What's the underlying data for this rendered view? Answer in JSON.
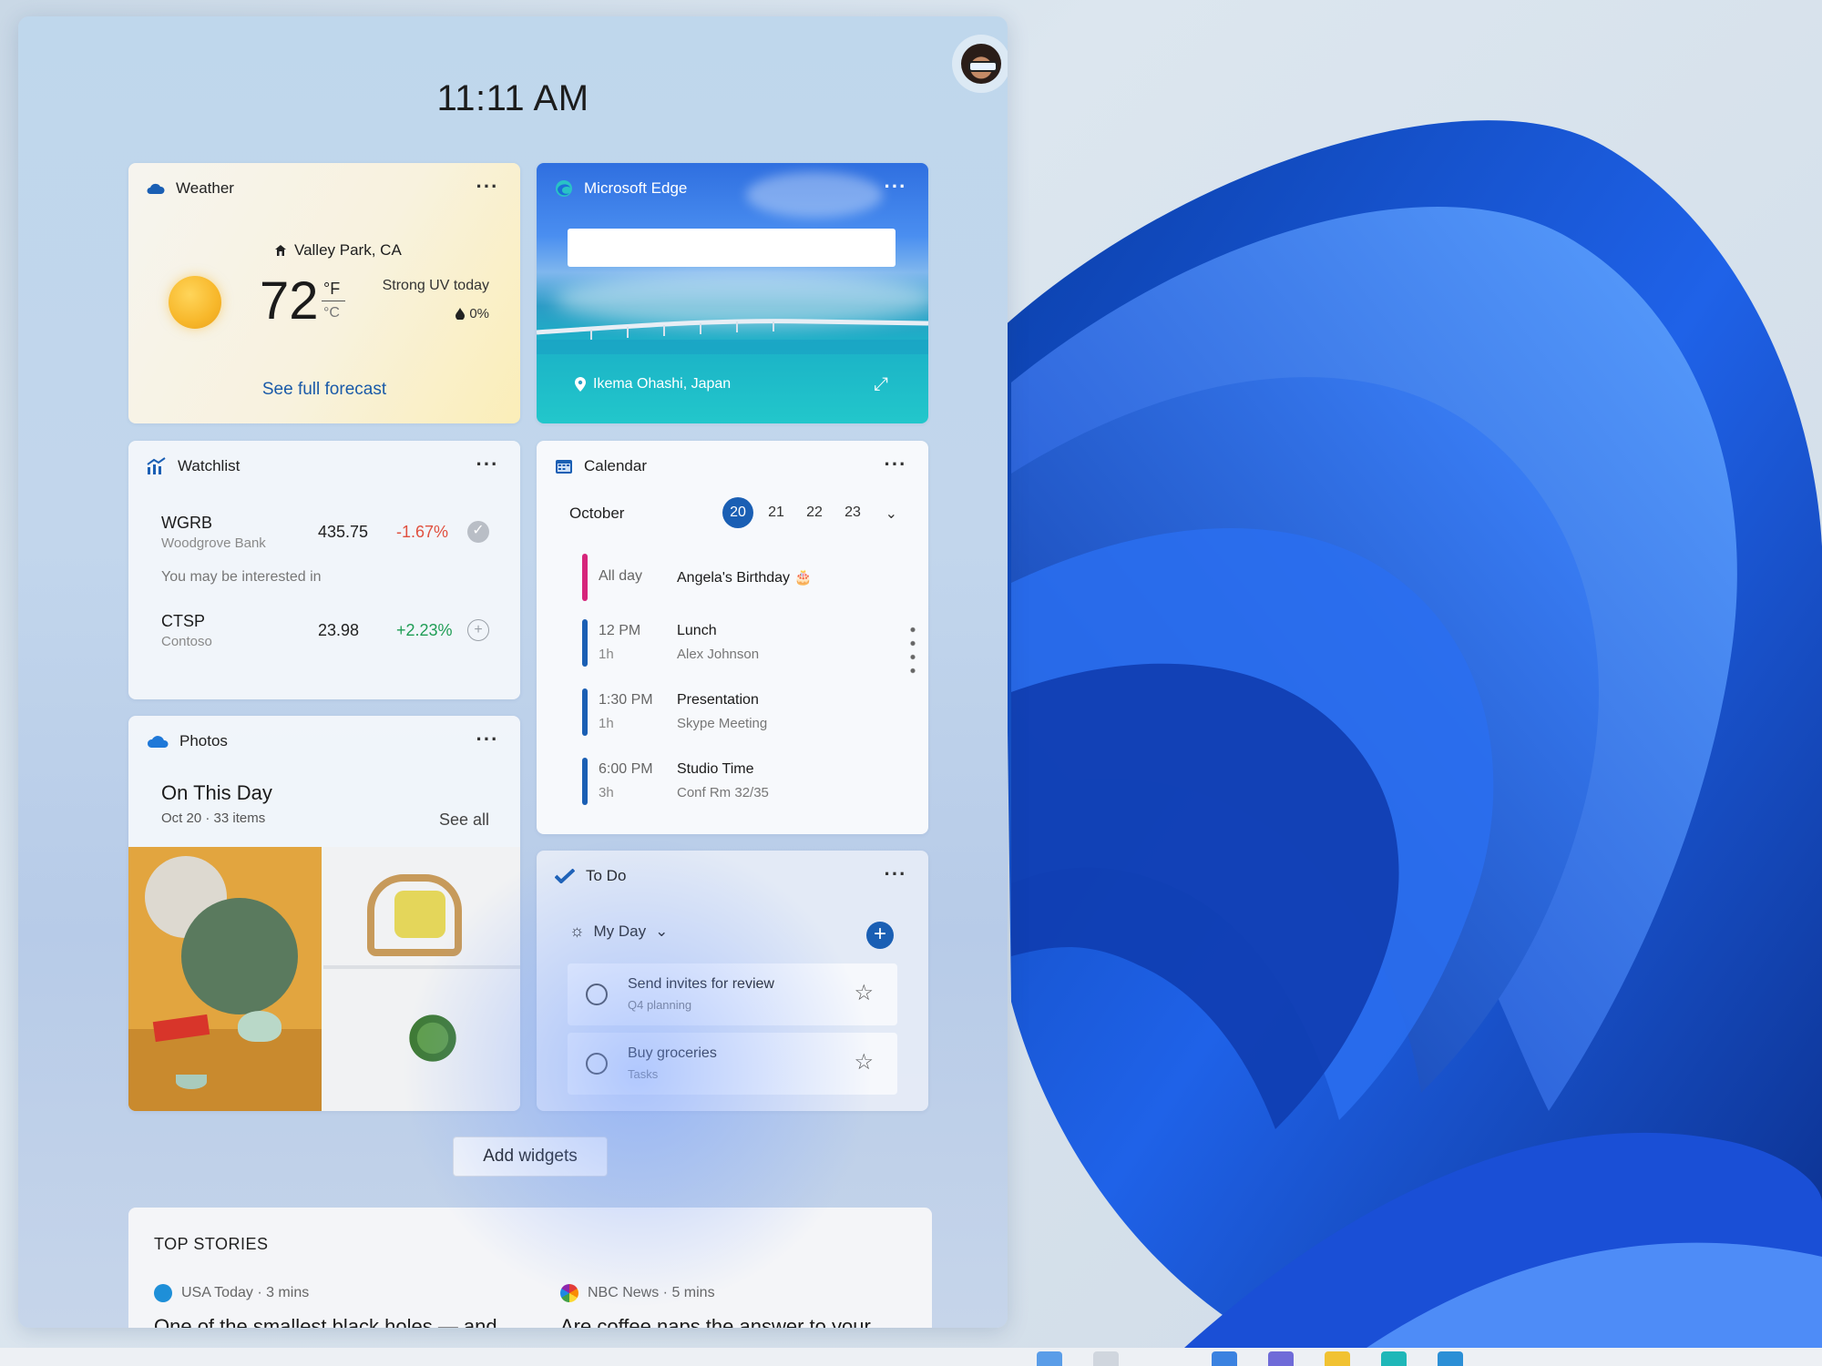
{
  "clock": {
    "time": "11:11 AM"
  },
  "weather": {
    "title": "Weather",
    "location": "Valley Park, CA",
    "temp": "72",
    "unit_f": "°F",
    "unit_c": "°C",
    "uv": "Strong UV today",
    "precip": "0%",
    "forecast_link": "See full forecast"
  },
  "edge": {
    "title": "Microsoft Edge",
    "search_placeholder": "",
    "location": "Ikema Ohashi, Japan"
  },
  "watchlist": {
    "title": "Watchlist",
    "stocks": [
      {
        "symbol": "WGRB",
        "name": "Woodgrove Bank",
        "price": "435.75",
        "change": "-1.67%"
      },
      {
        "symbol": "CTSP",
        "name": "Contoso",
        "price": "23.98",
        "change": "+2.23%"
      }
    ],
    "note": "You may be interested in"
  },
  "photos": {
    "title": "Photos",
    "heading": "On This Day",
    "sub": "Oct 20 · 33 items",
    "see_all": "See all"
  },
  "calendar": {
    "title": "Calendar",
    "month": "October",
    "days": [
      "20",
      "21",
      "22",
      "23"
    ],
    "events": [
      {
        "time": "All day",
        "dur": "",
        "name": "Angela's Birthday 🎂",
        "detail": ""
      },
      {
        "time": "12 PM",
        "dur": "1h",
        "name": "Lunch",
        "detail": "Alex Johnson"
      },
      {
        "time": "1:30 PM",
        "dur": "1h",
        "name": "Presentation",
        "detail": "Skype Meeting"
      },
      {
        "time": "6:00 PM",
        "dur": "3h",
        "name": "Studio Time",
        "detail": "Conf Rm 32/35"
      }
    ]
  },
  "todo": {
    "title": "To Do",
    "list": "My Day",
    "tasks": [
      {
        "title": "Send invites for review",
        "sub": "Q4 planning"
      },
      {
        "title": "Buy groceries",
        "sub": "Tasks"
      }
    ]
  },
  "add_widgets": "Add widgets",
  "stories": {
    "title": "TOP STORIES",
    "items": [
      {
        "source": "USA Today · 3 mins",
        "headline": "One of the smallest black holes — and"
      },
      {
        "source": "NBC News · 5 mins",
        "headline": "Are coffee naps the answer to your"
      }
    ]
  },
  "colors": {
    "accent": "#1a5fb4",
    "negative": "#e0503f",
    "positive": "#1f9d55",
    "birthday_bar": "#d6247a"
  }
}
